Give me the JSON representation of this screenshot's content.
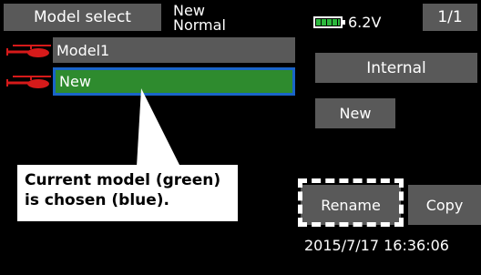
{
  "header": {
    "title_button": "Model select",
    "model_name": "New",
    "model_mode": "Normal",
    "battery_voltage": "6.2V",
    "page_indicator": "1/1"
  },
  "models": [
    {
      "label": "Model1",
      "icon": "helicopter-icon",
      "state": "normal"
    },
    {
      "label": "New",
      "icon": "helicopter-icon",
      "state": "current-selected"
    }
  ],
  "actions": {
    "internal_label": "Internal",
    "new_label": "New",
    "rename_label": "Rename",
    "copy_label": "Copy"
  },
  "callout": {
    "line1": "Current model (green)",
    "line2": "is chosen (blue)."
  },
  "datetime": "2015/7/17 16:36:06",
  "colors": {
    "current_model": "#2e8b2e",
    "selection_border": "#1a64c8",
    "button_bg": "#595959",
    "icon_red": "#d61a1a",
    "battery_green": "#2db83d"
  }
}
